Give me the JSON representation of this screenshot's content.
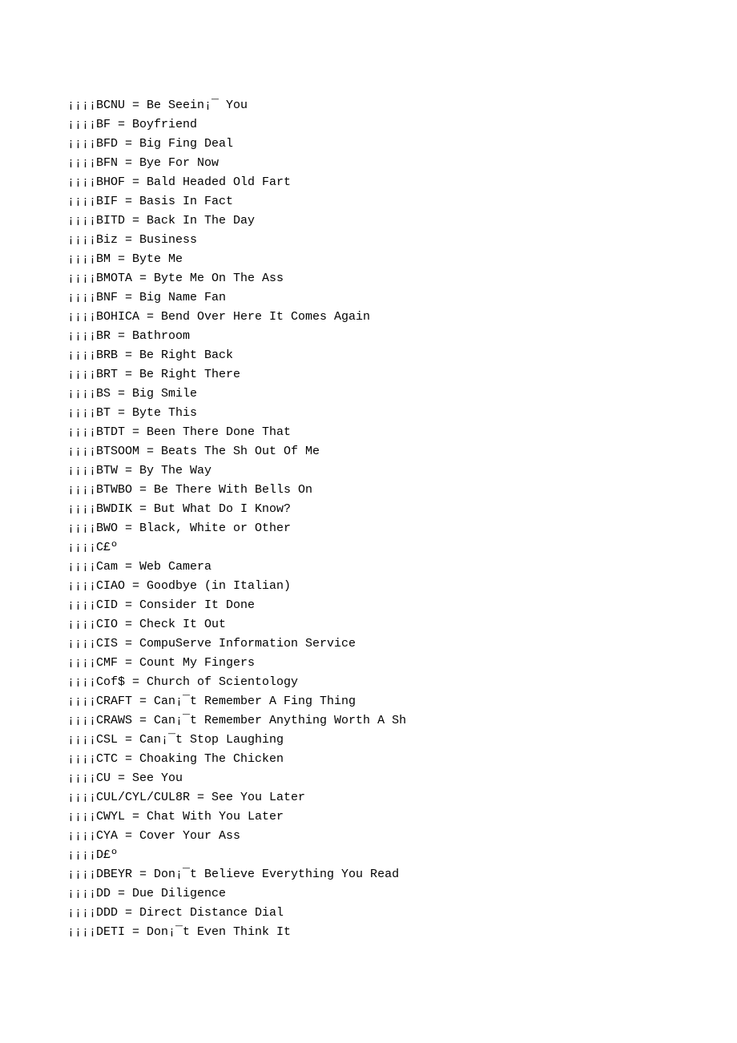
{
  "lines": [
    "¡¡¡¡BCNU = Be Seein¡¯ You",
    "¡¡¡¡BF = Boyfriend",
    "¡¡¡¡BFD = Big Fing Deal",
    "¡¡¡¡BFN = Bye For Now",
    "¡¡¡¡BHOF = Bald Headed Old Fart",
    "¡¡¡¡BIF = Basis In Fact",
    "¡¡¡¡BITD = Back In The Day",
    "¡¡¡¡Biz = Business",
    "¡¡¡¡BM = Byte Me",
    "¡¡¡¡BMOTA = Byte Me On The Ass",
    "¡¡¡¡BNF = Big Name Fan",
    "¡¡¡¡BOHICA = Bend Over Here It Comes Again",
    "¡¡¡¡BR = Bathroom",
    "¡¡¡¡BRB = Be Right Back",
    "¡¡¡¡BRT = Be Right There",
    "¡¡¡¡BS = Big Smile",
    "¡¡¡¡BT = Byte This",
    "¡¡¡¡BTDT = Been There Done That",
    "¡¡¡¡BTSOOM = Beats The Sh Out Of Me",
    "¡¡¡¡BTW = By The Way",
    "¡¡¡¡BTWBO = Be There With Bells On",
    "¡¡¡¡BWDIK = But What Do I Know?",
    "¡¡¡¡BWO = Black, White or Other",
    "¡¡¡¡C£º",
    "¡¡¡¡Cam = Web Camera",
    "¡¡¡¡CIAO = Goodbye (in Italian)",
    "¡¡¡¡CID = Consider It Done",
    "¡¡¡¡CIO = Check It Out",
    "¡¡¡¡CIS = CompuServe Information Service",
    "¡¡¡¡CMF = Count My Fingers",
    "¡¡¡¡Cof$ = Church of Scientology",
    "¡¡¡¡CRAFT = Can¡¯t Remember A Fing Thing",
    "¡¡¡¡CRAWS = Can¡¯t Remember Anything Worth A Sh",
    "¡¡¡¡CSL = Can¡¯t Stop Laughing",
    "¡¡¡¡CTC = Choaking The Chicken",
    "¡¡¡¡CU = See You",
    "¡¡¡¡CUL/CYL/CUL8R = See You Later",
    "¡¡¡¡CWYL = Chat With You Later",
    "¡¡¡¡CYA = Cover Your Ass",
    "¡¡¡¡D£º",
    "¡¡¡¡DBEYR = Don¡¯t Believe Everything You Read",
    "¡¡¡¡DD = Due Diligence",
    "¡¡¡¡DDD = Direct Distance Dial",
    "¡¡¡¡DETI = Don¡¯t Even Think It"
  ]
}
